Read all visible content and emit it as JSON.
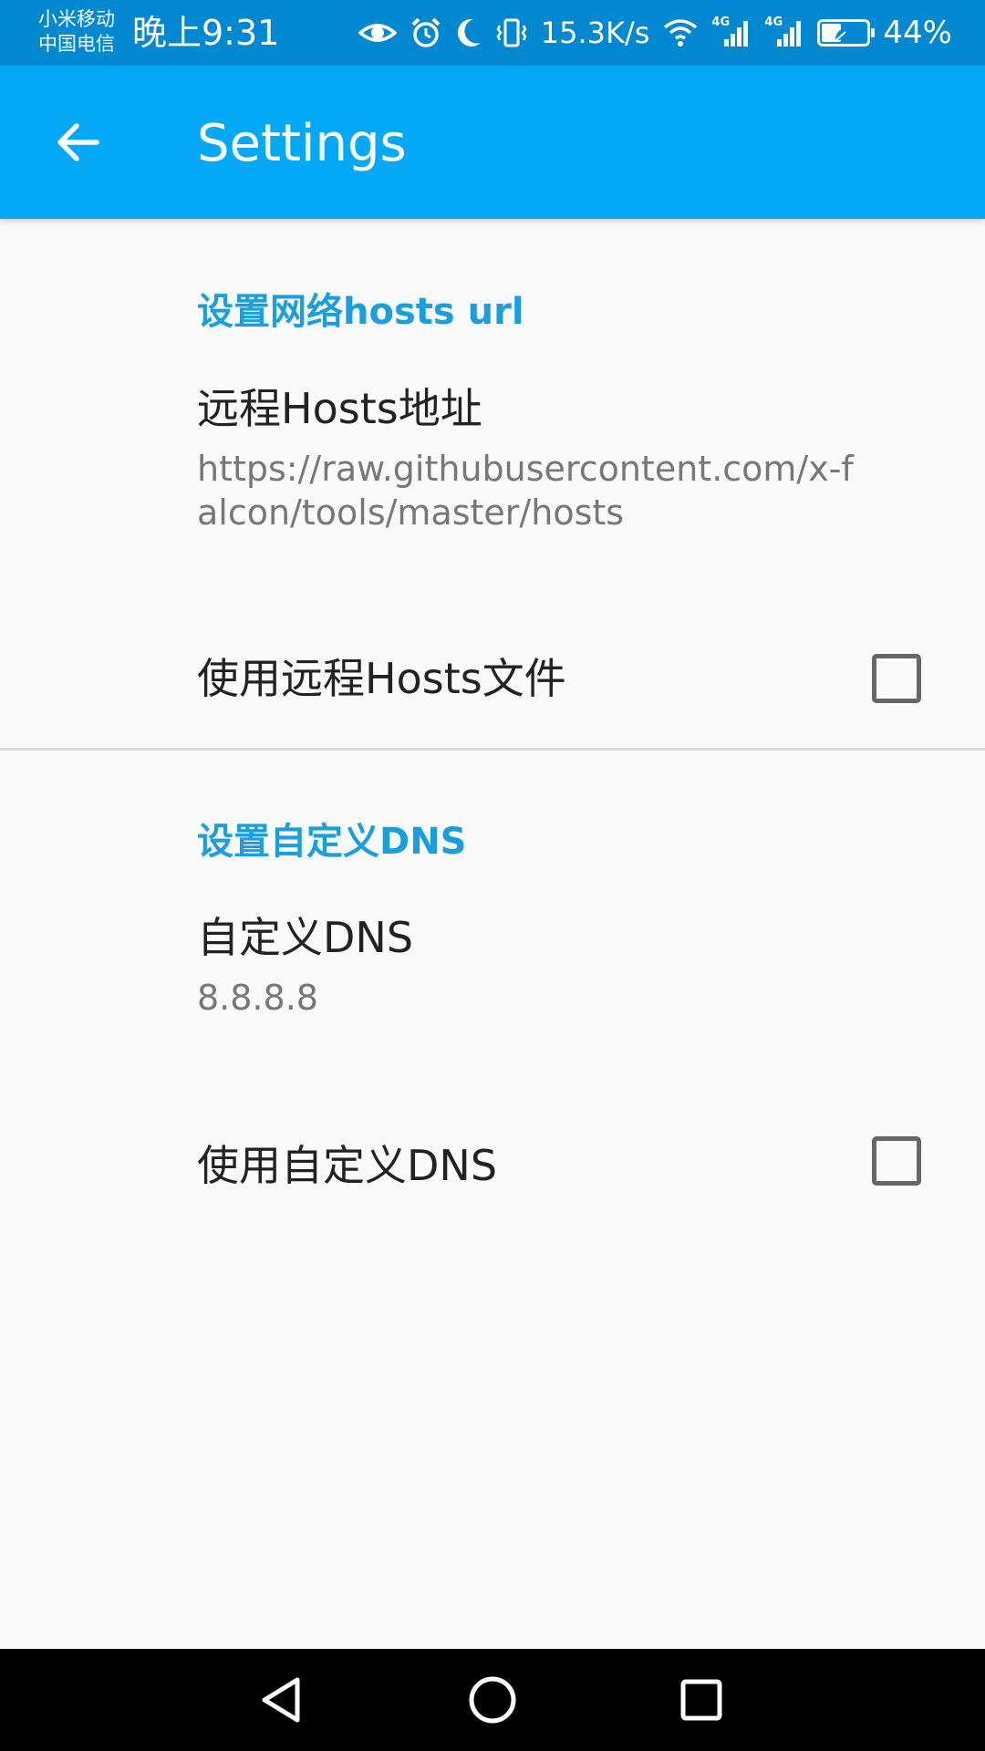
{
  "status_bar": {
    "carrier_line1": "小米移动",
    "carrier_line2": "中国电信",
    "time": "晚上9:31",
    "net_speed": "15.3K/s",
    "network_badge_1": "4G",
    "network_badge_2": "4G",
    "battery_percent": "44%",
    "battery_level": 0.44,
    "icons": [
      "eye-icon",
      "alarm-icon",
      "moon-icon",
      "vibrate-icon",
      "wifi-icon",
      "signal-icon",
      "signal-icon",
      "battery-icon"
    ]
  },
  "app_bar": {
    "title": "Settings",
    "back_icon": "arrow-back-icon"
  },
  "sections": {
    "hosts": {
      "category_title": "设置网络hosts url",
      "remote_hosts_title": "远程Hosts地址",
      "remote_hosts_summary": "https://raw.githubusercontent.com/x-falcon/tools/master/hosts",
      "use_remote_hosts_title": "使用远程Hosts文件",
      "use_remote_hosts_checked": false
    },
    "dns": {
      "category_title": "设置自定义DNS",
      "custom_dns_title": "自定义DNS",
      "custom_dns_summary": "8.8.8.8",
      "use_custom_dns_title": "使用自定义DNS",
      "use_custom_dns_checked": false
    }
  },
  "nav_bar": {
    "icons": [
      "back-triangle-icon",
      "home-circle-icon",
      "recents-square-icon"
    ]
  },
  "colors": {
    "status_bar": "#0288d1",
    "app_bar": "#03a9f4",
    "accent": "#1a9fde",
    "background": "#fafafa"
  }
}
